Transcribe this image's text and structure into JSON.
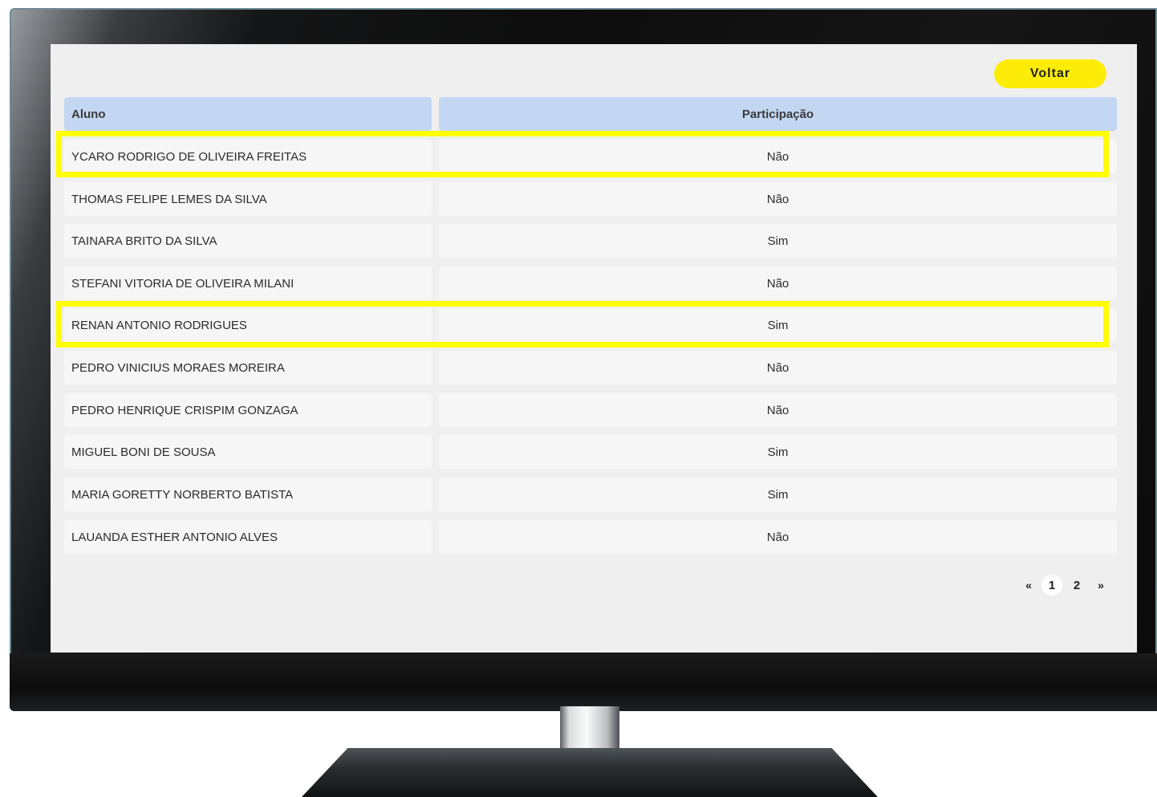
{
  "header": {
    "back_label": "Voltar"
  },
  "table": {
    "columns": [
      "Aluno",
      "Participação"
    ],
    "rows": [
      {
        "name": "YCARO RODRIGO DE OLIVEIRA FREITAS",
        "participation": "Não"
      },
      {
        "name": "THOMAS FELIPE LEMES DA SILVA",
        "participation": "Não"
      },
      {
        "name": "TAINARA BRITO DA SILVA",
        "participation": "Sim"
      },
      {
        "name": "STEFANI VITORIA DE OLIVEIRA MILANI",
        "participation": "Não"
      },
      {
        "name": "RENAN ANTONIO RODRIGUES",
        "participation": "Sim"
      },
      {
        "name": "PEDRO VINICIUS MORAES MOREIRA",
        "participation": "Não"
      },
      {
        "name": "PEDRO HENRIQUE CRISPIM GONZAGA",
        "participation": "Não"
      },
      {
        "name": "MIGUEL BONI DE SOUSA",
        "participation": "Sim"
      },
      {
        "name": "MARIA GORETTY NORBERTO BATISTA",
        "participation": "Sim"
      },
      {
        "name": "LAUANDA ESTHER ANTONIO ALVES",
        "participation": "Não"
      }
    ]
  },
  "pagination": {
    "prev": "«",
    "pages": [
      "1",
      "2"
    ],
    "current": "1",
    "next": "»"
  },
  "colors": {
    "accent": "#fcec08",
    "header_bg": "#c3d7f3",
    "highlight": "#ffff00"
  }
}
